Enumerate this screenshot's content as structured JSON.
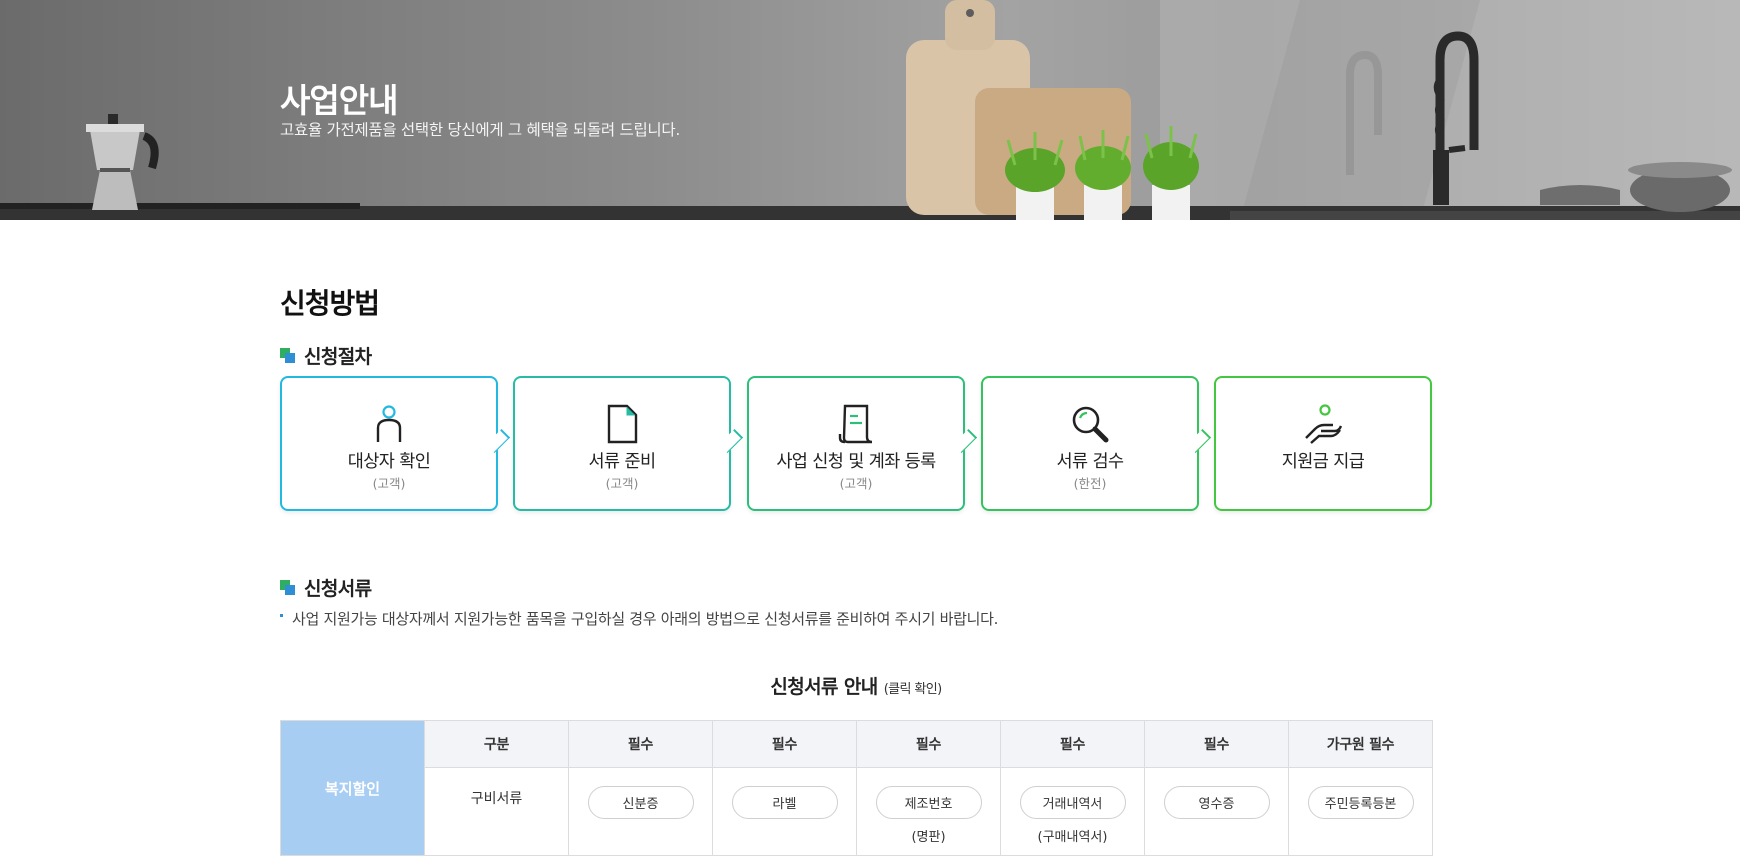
{
  "hero": {
    "title": "사업안내",
    "subtitle": "고효율 가전제품을 선택한 당신에게 그 혜택을 되돌려 드립니다."
  },
  "main_title": "신청방법",
  "procedure": {
    "heading": "신청절차",
    "steps": [
      {
        "label": "대상자 확인",
        "sub": "(고객)",
        "icon": "person-icon",
        "color": "#22b8e0"
      },
      {
        "label": "서류 준비",
        "sub": "(고객)",
        "icon": "document-icon",
        "color": "#27bba3"
      },
      {
        "label": "사업 신청 및 계좌 등록",
        "sub": "(고객)",
        "icon": "receipt-icon",
        "color": "#2cbf7c"
      },
      {
        "label": "서류 검수",
        "sub": "(한전)",
        "icon": "search-icon",
        "color": "#35c35c"
      },
      {
        "label": "지원금 지급",
        "sub": "",
        "icon": "hand-coin-icon",
        "color": "#45c640"
      }
    ]
  },
  "documents": {
    "heading": "신청서류",
    "description": "사업 지원가능 대상자께서 지원가능한 품목을 구입하실 경우 아래의 방법으로 신청서류를 준비하여 주시기 바랍니다.",
    "table_title": "신청서류 안내",
    "table_title_note": "(클릭 확인)",
    "table": {
      "row_header": "복지할인",
      "headers": [
        "구분",
        "필수",
        "필수",
        "필수",
        "필수",
        "필수",
        "가구원 필수"
      ],
      "kind": "구비서류",
      "items": [
        {
          "label": "신분증",
          "note": ""
        },
        {
          "label": "라벨",
          "note": ""
        },
        {
          "label": "제조번호",
          "note": "(명판)"
        },
        {
          "label": "거래내역서",
          "note": "(구매내역서)"
        },
        {
          "label": "영수증",
          "note": ""
        },
        {
          "label": "주민등록등본",
          "note": ""
        }
      ]
    }
  }
}
